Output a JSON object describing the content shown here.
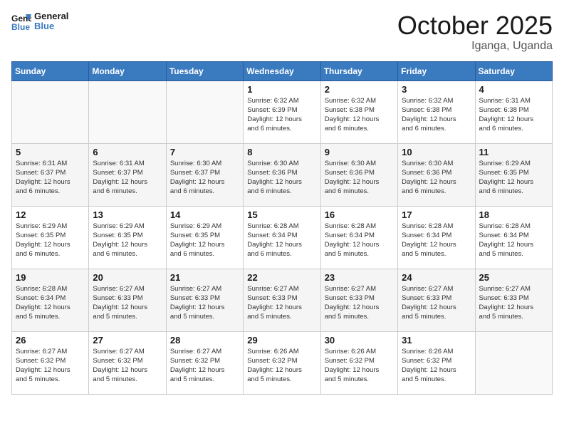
{
  "header": {
    "logo_line1": "General",
    "logo_line2": "Blue",
    "month": "October 2025",
    "location": "Iganga, Uganda"
  },
  "weekdays": [
    "Sunday",
    "Monday",
    "Tuesday",
    "Wednesday",
    "Thursday",
    "Friday",
    "Saturday"
  ],
  "weeks": [
    [
      {
        "day": "",
        "info": ""
      },
      {
        "day": "",
        "info": ""
      },
      {
        "day": "",
        "info": ""
      },
      {
        "day": "1",
        "info": "Sunrise: 6:32 AM\nSunset: 6:39 PM\nDaylight: 12 hours\nand 6 minutes."
      },
      {
        "day": "2",
        "info": "Sunrise: 6:32 AM\nSunset: 6:38 PM\nDaylight: 12 hours\nand 6 minutes."
      },
      {
        "day": "3",
        "info": "Sunrise: 6:32 AM\nSunset: 6:38 PM\nDaylight: 12 hours\nand 6 minutes."
      },
      {
        "day": "4",
        "info": "Sunrise: 6:31 AM\nSunset: 6:38 PM\nDaylight: 12 hours\nand 6 minutes."
      }
    ],
    [
      {
        "day": "5",
        "info": "Sunrise: 6:31 AM\nSunset: 6:37 PM\nDaylight: 12 hours\nand 6 minutes."
      },
      {
        "day": "6",
        "info": "Sunrise: 6:31 AM\nSunset: 6:37 PM\nDaylight: 12 hours\nand 6 minutes."
      },
      {
        "day": "7",
        "info": "Sunrise: 6:30 AM\nSunset: 6:37 PM\nDaylight: 12 hours\nand 6 minutes."
      },
      {
        "day": "8",
        "info": "Sunrise: 6:30 AM\nSunset: 6:36 PM\nDaylight: 12 hours\nand 6 minutes."
      },
      {
        "day": "9",
        "info": "Sunrise: 6:30 AM\nSunset: 6:36 PM\nDaylight: 12 hours\nand 6 minutes."
      },
      {
        "day": "10",
        "info": "Sunrise: 6:30 AM\nSunset: 6:36 PM\nDaylight: 12 hours\nand 6 minutes."
      },
      {
        "day": "11",
        "info": "Sunrise: 6:29 AM\nSunset: 6:35 PM\nDaylight: 12 hours\nand 6 minutes."
      }
    ],
    [
      {
        "day": "12",
        "info": "Sunrise: 6:29 AM\nSunset: 6:35 PM\nDaylight: 12 hours\nand 6 minutes."
      },
      {
        "day": "13",
        "info": "Sunrise: 6:29 AM\nSunset: 6:35 PM\nDaylight: 12 hours\nand 6 minutes."
      },
      {
        "day": "14",
        "info": "Sunrise: 6:29 AM\nSunset: 6:35 PM\nDaylight: 12 hours\nand 6 minutes."
      },
      {
        "day": "15",
        "info": "Sunrise: 6:28 AM\nSunset: 6:34 PM\nDaylight: 12 hours\nand 6 minutes."
      },
      {
        "day": "16",
        "info": "Sunrise: 6:28 AM\nSunset: 6:34 PM\nDaylight: 12 hours\nand 5 minutes."
      },
      {
        "day": "17",
        "info": "Sunrise: 6:28 AM\nSunset: 6:34 PM\nDaylight: 12 hours\nand 5 minutes."
      },
      {
        "day": "18",
        "info": "Sunrise: 6:28 AM\nSunset: 6:34 PM\nDaylight: 12 hours\nand 5 minutes."
      }
    ],
    [
      {
        "day": "19",
        "info": "Sunrise: 6:28 AM\nSunset: 6:34 PM\nDaylight: 12 hours\nand 5 minutes."
      },
      {
        "day": "20",
        "info": "Sunrise: 6:27 AM\nSunset: 6:33 PM\nDaylight: 12 hours\nand 5 minutes."
      },
      {
        "day": "21",
        "info": "Sunrise: 6:27 AM\nSunset: 6:33 PM\nDaylight: 12 hours\nand 5 minutes."
      },
      {
        "day": "22",
        "info": "Sunrise: 6:27 AM\nSunset: 6:33 PM\nDaylight: 12 hours\nand 5 minutes."
      },
      {
        "day": "23",
        "info": "Sunrise: 6:27 AM\nSunset: 6:33 PM\nDaylight: 12 hours\nand 5 minutes."
      },
      {
        "day": "24",
        "info": "Sunrise: 6:27 AM\nSunset: 6:33 PM\nDaylight: 12 hours\nand 5 minutes."
      },
      {
        "day": "25",
        "info": "Sunrise: 6:27 AM\nSunset: 6:33 PM\nDaylight: 12 hours\nand 5 minutes."
      }
    ],
    [
      {
        "day": "26",
        "info": "Sunrise: 6:27 AM\nSunset: 6:32 PM\nDaylight: 12 hours\nand 5 minutes."
      },
      {
        "day": "27",
        "info": "Sunrise: 6:27 AM\nSunset: 6:32 PM\nDaylight: 12 hours\nand 5 minutes."
      },
      {
        "day": "28",
        "info": "Sunrise: 6:27 AM\nSunset: 6:32 PM\nDaylight: 12 hours\nand 5 minutes."
      },
      {
        "day": "29",
        "info": "Sunrise: 6:26 AM\nSunset: 6:32 PM\nDaylight: 12 hours\nand 5 minutes."
      },
      {
        "day": "30",
        "info": "Sunrise: 6:26 AM\nSunset: 6:32 PM\nDaylight: 12 hours\nand 5 minutes."
      },
      {
        "day": "31",
        "info": "Sunrise: 6:26 AM\nSunset: 6:32 PM\nDaylight: 12 hours\nand 5 minutes."
      },
      {
        "day": "",
        "info": ""
      }
    ]
  ]
}
